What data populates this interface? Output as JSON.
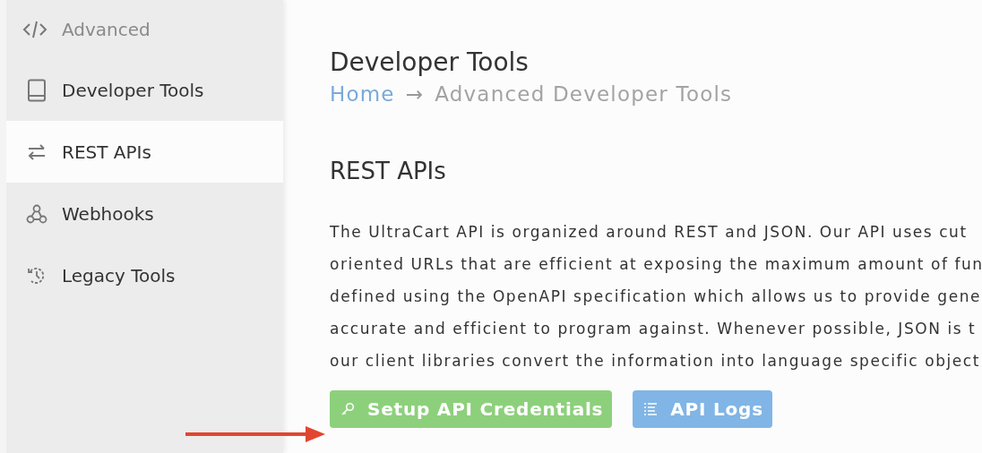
{
  "sidebar": {
    "header": "Advanced",
    "items": [
      {
        "label": "Developer Tools",
        "selected": false
      },
      {
        "label": "REST APIs",
        "selected": true
      },
      {
        "label": "Webhooks",
        "selected": false
      },
      {
        "label": "Legacy Tools",
        "selected": false
      }
    ]
  },
  "page": {
    "title": "Developer Tools",
    "breadcrumb": [
      {
        "label": "Home",
        "kind": "link"
      },
      {
        "label": "→",
        "kind": "separator"
      },
      {
        "label": "Advanced Developer Tools",
        "kind": "current"
      }
    ]
  },
  "section": {
    "heading": "REST APIs",
    "lines": [
      "The UltraCart API is organized around REST and JSON. Our API uses cut",
      "oriented URLs that are efficient at exposing the maximum amount of fun",
      "defined using the OpenAPI specification which allows us to provide gene",
      "accurate and efficient to program against. Whenever possible, JSON is t",
      "our client libraries convert the information into language specific object"
    ],
    "buttons": [
      {
        "label": "Setup API Credentials",
        "kind": "success"
      },
      {
        "label": "API Logs",
        "kind": "info"
      }
    ]
  }
}
